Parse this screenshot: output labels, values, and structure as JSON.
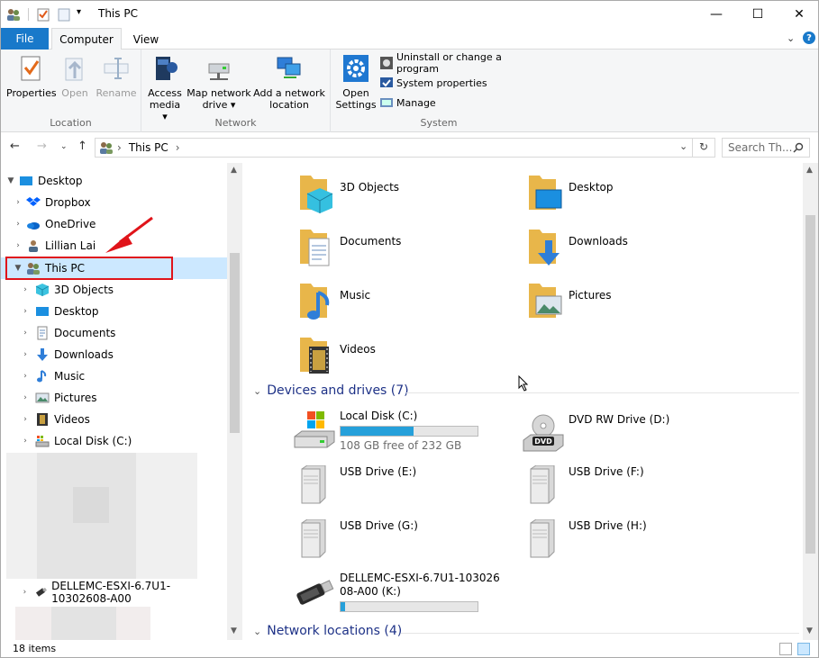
{
  "window": {
    "title": "This PC",
    "minimize_glyph": "—",
    "maximize_glyph": "☐",
    "close_glyph": "✕"
  },
  "ribbon_tabs": {
    "file": "File",
    "computer": "Computer",
    "view": "View",
    "help": "?"
  },
  "ribbon": {
    "location": {
      "label": "Location",
      "properties": "Properties",
      "open": "Open",
      "rename": "Rename"
    },
    "network": {
      "label": "Network",
      "access_media_1": "Access",
      "access_media_2": "media ▾",
      "map_drive_1": "Map network",
      "map_drive_2": "drive ▾",
      "add_location_1": "Add a network",
      "add_location_2": "location"
    },
    "system": {
      "label": "System",
      "open_settings_1": "Open",
      "open_settings_2": "Settings",
      "uninstall": "Uninstall or change a program",
      "system_properties": "System properties",
      "manage": "Manage"
    }
  },
  "address_bar": {
    "path": "This PC",
    "search_placeholder": "Search Th..."
  },
  "nav_tree": [
    {
      "label": "Desktop",
      "level": 0,
      "expanded": true
    },
    {
      "label": "Dropbox",
      "level": 1
    },
    {
      "label": "OneDrive",
      "level": 1
    },
    {
      "label": "Lillian Lai",
      "level": 1
    },
    {
      "label": "This PC",
      "level": 1,
      "expanded": true,
      "selected": true
    },
    {
      "label": "3D Objects",
      "level": 2
    },
    {
      "label": "Desktop",
      "level": 2
    },
    {
      "label": "Documents",
      "level": 2
    },
    {
      "label": "Downloads",
      "level": 2
    },
    {
      "label": "Music",
      "level": 2
    },
    {
      "label": "Pictures",
      "level": 2
    },
    {
      "label": "Videos",
      "level": 2
    },
    {
      "label": "Local Disk (C:)",
      "level": 2
    },
    {
      "label": "DELLEMC-ESXI-6.7U1-10302608-A00",
      "level": 2
    }
  ],
  "folders": [
    {
      "label": "3D Objects"
    },
    {
      "label": "Desktop"
    },
    {
      "label": "Documents"
    },
    {
      "label": "Downloads"
    },
    {
      "label": "Music"
    },
    {
      "label": "Pictures"
    },
    {
      "label": "Videos"
    }
  ],
  "groups": {
    "devices": "Devices and drives (7)",
    "network": "Network locations (4)"
  },
  "drives": [
    {
      "label": "Local Disk (C:)",
      "free": "108 GB free of 232 GB",
      "used_fraction": 0.53
    },
    {
      "label": "DVD RW Drive (D:)"
    },
    {
      "label": "USB Drive (E:)"
    },
    {
      "label": "USB Drive (F:)"
    },
    {
      "label": "USB Drive (G:)"
    },
    {
      "label": "USB Drive (H:)"
    },
    {
      "label_1": "DELLEMC-ESXI-6.7U1-103026",
      "label_2": "08-A00 (K:)",
      "used_fraction": 0.03
    }
  ],
  "status": {
    "items": "18 items"
  },
  "colors": {
    "accent": "#1979ca",
    "selection": "#cce8ff",
    "highlight_box": "#e0141a",
    "drive_bar": "#26a0da",
    "group_header": "#1e3287"
  }
}
